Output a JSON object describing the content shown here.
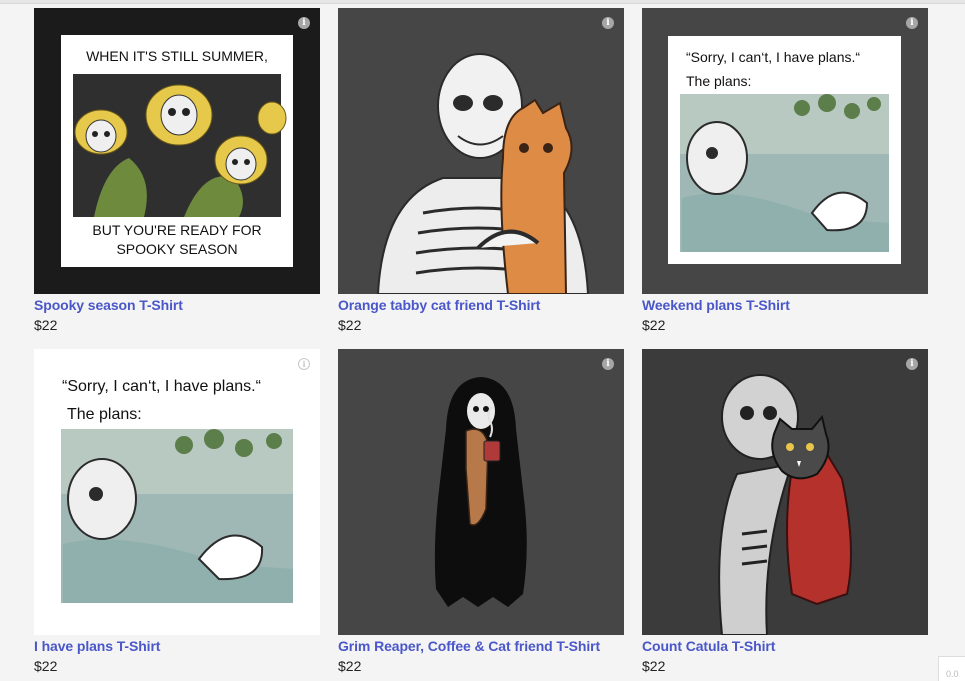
{
  "colors": {
    "link": "#4a57c9",
    "price": "#222222",
    "page_bg": "#f4f4f4"
  },
  "info_icon_glyph": "i",
  "products": [
    {
      "title": "Spooky season T-Shirt",
      "price": "$22",
      "art": {
        "top_text": "WHEN IT'S STILL SUMMER,",
        "bottom_line1": "BUT YOU'RE READY FOR",
        "bottom_line2": "SPOOKY SEASON"
      }
    },
    {
      "title": "Orange tabby cat friend T-Shirt",
      "price": "$22"
    },
    {
      "title": "Weekend plans T-Shirt",
      "price": "$22",
      "art": {
        "quote": "“Sorry, I can‘t, I have plans.“",
        "sub": "The plans:"
      }
    },
    {
      "title": "I have plans T-Shirt",
      "price": "$22",
      "art": {
        "quote": "“Sorry, I can‘t, I have plans.“",
        "sub": "The plans:"
      }
    },
    {
      "title": "Grim Reaper, Coffee & Cat friend T-Shirt",
      "price": "$22"
    },
    {
      "title": "Count Catula T-Shirt",
      "price": "$22"
    }
  ],
  "corner_badge": "0.0"
}
